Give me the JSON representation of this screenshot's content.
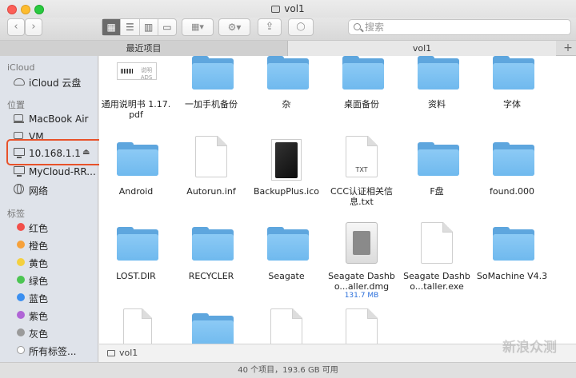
{
  "window": {
    "title": "vol1"
  },
  "toolbar": {
    "back_label": "‹",
    "forward_label": "›",
    "view_modes": [
      "▦",
      "☰",
      "▥",
      "▭"
    ],
    "arrange_label": "▦▾",
    "action_label": "⚙▾",
    "share_label": "⇪",
    "tag_label": "◯",
    "search_placeholder": "搜索"
  },
  "tabs": {
    "items": [
      "最近项目",
      "vol1"
    ],
    "add_label": "+"
  },
  "sidebar": {
    "sections": {
      "icloud": "iCloud",
      "locations": "位置",
      "tags": "标签"
    },
    "icloud_items": [
      "iCloud 云盘"
    ],
    "location_items": [
      "MacBook Air",
      "VM",
      "10.168.1.1",
      "MyCloud-RR...",
      "网络"
    ],
    "eject_label": "⏏",
    "tag_items": [
      {
        "label": "红色",
        "color": "#f2504b"
      },
      {
        "label": "橙色",
        "color": "#f6a13b"
      },
      {
        "label": "黄色",
        "color": "#f4d03f"
      },
      {
        "label": "绿色",
        "color": "#4cc552"
      },
      {
        "label": "蓝色",
        "color": "#3b8ff0"
      },
      {
        "label": "紫色",
        "color": "#b065d6"
      },
      {
        "label": "灰色",
        "color": "#9a9a9a"
      },
      {
        "label": "所有标签...",
        "color": "#ffffff"
      }
    ]
  },
  "files": [
    {
      "name": "通用说明书 1.17.pdf",
      "kind": "pdf",
      "thumb_text": "说明ADS"
    },
    {
      "name": "一加手机备份",
      "kind": "folder"
    },
    {
      "name": "杂",
      "kind": "folder"
    },
    {
      "name": "桌面备份",
      "kind": "folder"
    },
    {
      "name": "资料",
      "kind": "folder"
    },
    {
      "name": "字体",
      "kind": "folder"
    },
    {
      "name": "Android",
      "kind": "folder"
    },
    {
      "name": "Autorun.inf",
      "kind": "doc"
    },
    {
      "name": "BackupPlus.ico",
      "kind": "hdd"
    },
    {
      "name": "CCC认证相关信息.txt",
      "kind": "txt",
      "badge": "TXT"
    },
    {
      "name": "F盘",
      "kind": "folder"
    },
    {
      "name": "found.000",
      "kind": "folder"
    },
    {
      "name": "LOST.DIR",
      "kind": "folder"
    },
    {
      "name": "RECYCLER",
      "kind": "folder"
    },
    {
      "name": "Seagate",
      "kind": "folder"
    },
    {
      "name": "Seagate Dashbo...aller.dmg",
      "kind": "dmg",
      "size": "131.7 MB"
    },
    {
      "name": "Seagate Dashbo...taller.exe",
      "kind": "doc"
    },
    {
      "name": "SoMachine V4.3",
      "kind": "folder"
    }
  ],
  "pathbar": {
    "label": "vol1"
  },
  "status": {
    "text": "40 个项目，193.6 GB 可用"
  },
  "watermark": {
    "text": "新浪众测"
  }
}
